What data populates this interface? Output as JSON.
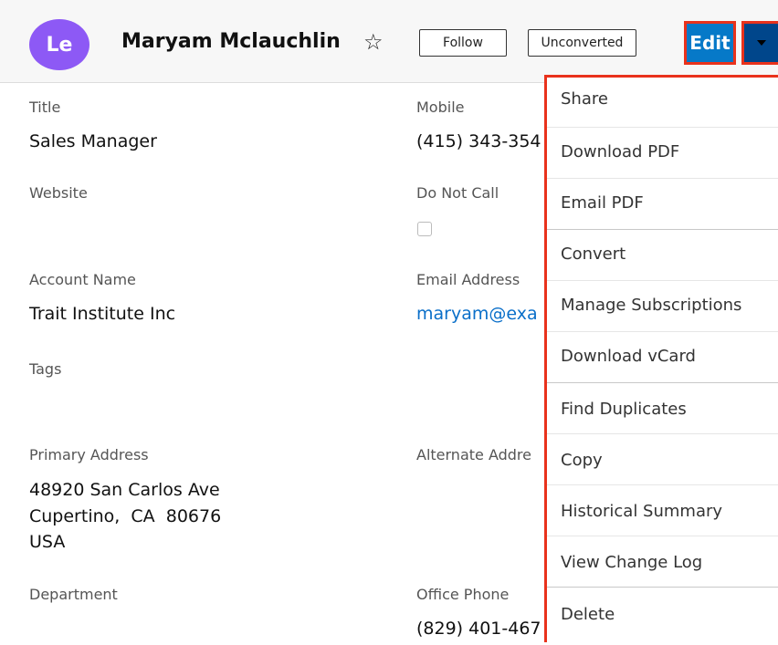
{
  "header": {
    "avatar_initials": "Le",
    "record_name": "Maryam Mclauchlin",
    "follow_label": "Follow",
    "status_label": "Unconverted",
    "edit_label": "Edit"
  },
  "fields": {
    "title": {
      "label": "Title",
      "value": "Sales Manager"
    },
    "mobile": {
      "label": "Mobile",
      "value": "(415) 343-354"
    },
    "website": {
      "label": "Website",
      "value": ""
    },
    "do_not_call": {
      "label": "Do Not Call",
      "checked": false
    },
    "account_name": {
      "label": "Account Name",
      "value": "Trait Institute Inc"
    },
    "email_address": {
      "label": "Email Address",
      "value": "maryam@exa"
    },
    "tags": {
      "label": "Tags",
      "value": ""
    },
    "primary_address": {
      "label": "Primary Address",
      "line1": "48920 San Carlos Ave",
      "line2": "Cupertino,  CA  80676",
      "line3": "USA"
    },
    "alternate_address": {
      "label": "Alternate Addre"
    },
    "department": {
      "label": "Department",
      "value": ""
    },
    "office_phone": {
      "label": "Office Phone",
      "value": "(829) 401-467"
    }
  },
  "menu": {
    "items": [
      "Share",
      "Download PDF",
      "Email PDF",
      "Convert",
      "Manage Subscriptions",
      "Download vCard",
      "Find Duplicates",
      "Copy",
      "Historical Summary",
      "View Change Log",
      "Delete"
    ]
  },
  "colors": {
    "avatar": "#8d59f5",
    "edit_button": "#0679c8",
    "dropdown_button": "#00468b",
    "highlight": "#e9321c",
    "link": "#0a6fc9"
  }
}
